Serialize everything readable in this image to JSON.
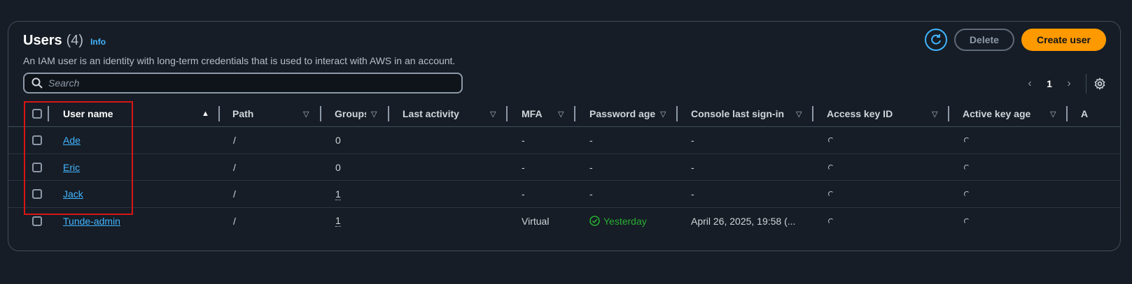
{
  "header": {
    "title": "Users",
    "count": "(4)",
    "info": "Info",
    "subtitle": "An IAM user is an identity with long-term credentials that is used to interact with AWS in an account."
  },
  "actions": {
    "refresh_icon": "refresh-icon",
    "delete_label": "Delete",
    "create_label": "Create user"
  },
  "search": {
    "placeholder": "Search",
    "value": ""
  },
  "pagination": {
    "current_page": "1"
  },
  "columns": [
    {
      "label": "User name",
      "sort": "▲"
    },
    {
      "label": "Path",
      "sort": "▽"
    },
    {
      "label": "Groups",
      "sort": "▽"
    },
    {
      "label": "Last activity",
      "sort": "▽"
    },
    {
      "label": "MFA",
      "sort": "▽"
    },
    {
      "label": "Password age",
      "sort": "▽"
    },
    {
      "label": "Console last sign-in",
      "sort": "▽"
    },
    {
      "label": "Access key ID",
      "sort": "▽"
    },
    {
      "label": "Active key age",
      "sort": "▽"
    },
    {
      "label": "A"
    }
  ],
  "rows": [
    {
      "name": "Ade",
      "path": "/",
      "groups": "0",
      "last_activity": "",
      "mfa": "-",
      "password_age": "-",
      "console_sign_in": "-"
    },
    {
      "name": "Eric",
      "path": "/",
      "groups": "0",
      "last_activity": "",
      "mfa": "-",
      "password_age": "-",
      "console_sign_in": "-"
    },
    {
      "name": "Jack",
      "path": "/",
      "groups": "1",
      "last_activity": "",
      "mfa": "-",
      "password_age": "-",
      "console_sign_in": "-"
    },
    {
      "name": "Tunde-admin",
      "path": "/",
      "groups": "1",
      "last_activity": "",
      "mfa": "Virtual",
      "password_age": "Yesterday",
      "console_sign_in": "April 26, 2025, 19:58 (..."
    }
  ],
  "colors": {
    "background": "#161d26",
    "link": "#42b4ff",
    "primary_button": "#ff9900",
    "success": "#29ad32",
    "highlight_box": "#d91515"
  }
}
